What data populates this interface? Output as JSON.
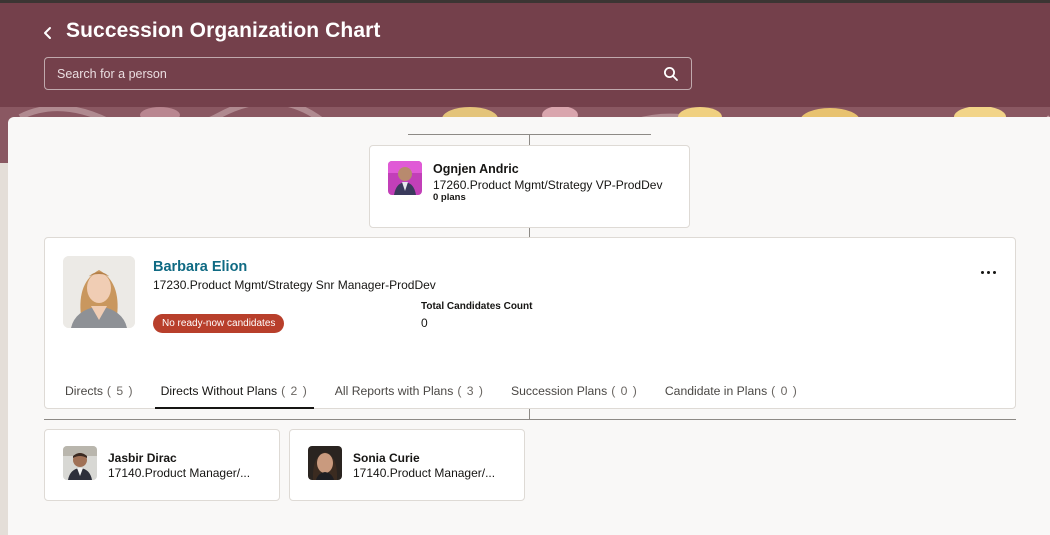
{
  "header": {
    "title": "Succession Organization Chart",
    "back_icon": "chevron-left-icon",
    "search_placeholder": "Search for a person",
    "search_icon": "search-icon"
  },
  "colors": {
    "header_bg": "#74404b",
    "link": "#0f6a83",
    "badge_bg": "#b83f2b",
    "canvas_bg": "#f9f8f7"
  },
  "manager": {
    "name": "Ognjen Andric",
    "title": "17260.Product Mgmt/Strategy VP-ProdDev",
    "plans": "0 plans"
  },
  "person": {
    "name": "Barbara Elion",
    "title": "17230.Product Mgmt/Strategy Snr Manager-ProdDev",
    "badge": "No ready-now candidates",
    "candidates_label": "Total Candidates Count",
    "candidates_value": "0",
    "more_icon": "more-options-icon"
  },
  "tabs": [
    {
      "label": "Directs",
      "count": "( 5 )",
      "active": false
    },
    {
      "label": "Directs Without Plans",
      "count": "( 2 )",
      "active": true
    },
    {
      "label": "All Reports with Plans",
      "count": "( 3 )",
      "active": false
    },
    {
      "label": "Succession Plans",
      "count": "( 0 )",
      "active": false
    },
    {
      "label": "Candidate in Plans",
      "count": "( 0 )",
      "active": false
    }
  ],
  "reports": [
    {
      "name": "Jasbir Dirac",
      "title": "17140.Product Manager/..."
    },
    {
      "name": "Sonia Curie",
      "title": "17140.Product Manager/..."
    }
  ]
}
